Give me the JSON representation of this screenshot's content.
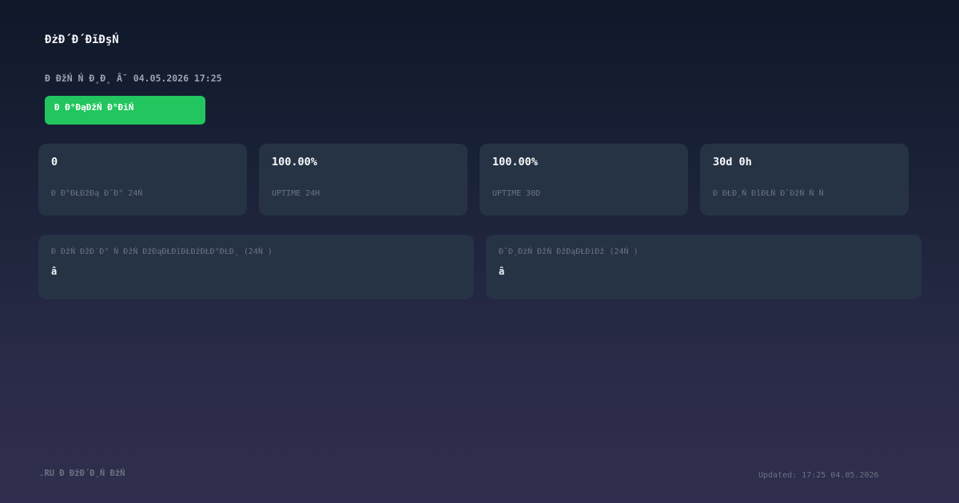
{
  "header": {
    "title": "ĐżĐ´Đ´ĐĭĐşŃ",
    "subtitle": "Đ ĐžŃ Ń Đ¸Đ¸ Â˘ 04.05.2026 17:25"
  },
  "status": {
    "label": "Đ Đ°ĐąĐžŃ Đ°ĐĭŃ",
    "color": "#22c55e"
  },
  "metrics": [
    {
      "value": "0",
      "label": "Đ Đ°ĐŁĐžĐą Đ˘Đ° 24Ń"
    },
    {
      "value": "100.00%",
      "label": "UPTIME 24H"
    },
    {
      "value": "100.00%",
      "label": "UPTIME 30D"
    },
    {
      "value": "30d 0h",
      "label": "Đ ĐŁĐ¸Ń ĐĭĐŁŃ Đ˘ĐžŃ Ń Ń"
    }
  ],
  "panels": [
    {
      "label": "Đ ĐžŃ ĐžĐ´Đ° Ń  ĐžŃ ĐžĐąĐŁĐĭĐŁĐžĐŁĐ°ĐŁĐ¸ (24Ń )",
      "value": "â"
    },
    {
      "label": "Đ˘Đ¸ĐżŃ  ĐžŃ ĐžĐąĐŁĐĭĐž (24Ń )",
      "value": "â"
    }
  ],
  "footer": {
    "brand": ".RU Đ ĐžĐ´Đ¸Ń ĐžŃ",
    "updated": "Updated: 17:25 04.05.2026"
  }
}
